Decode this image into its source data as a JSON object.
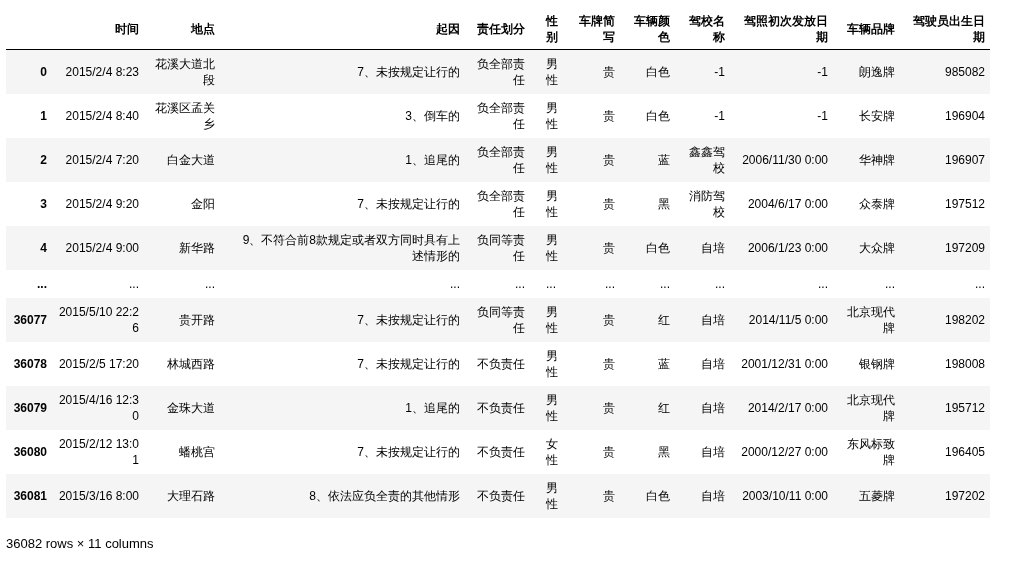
{
  "table": {
    "columns": [
      "时间",
      "地点",
      "起因",
      "责任划分",
      "性别",
      "车牌简写",
      "车辆颜色",
      "驾校名称",
      "驾照初次发放日期",
      "车辆品牌",
      "驾驶员出生日期"
    ],
    "rows": [
      {
        "index": "0",
        "cells": [
          "2015/2/4 8:23",
          "花溪大道北段",
          "7、未按规定让行的",
          "负全部责任",
          "男性",
          "贵",
          "白色",
          "-1",
          "-1",
          "朗逸牌",
          "985082"
        ]
      },
      {
        "index": "1",
        "cells": [
          "2015/2/4 8:40",
          "花溪区孟关乡",
          "3、倒车的",
          "负全部责任",
          "男性",
          "贵",
          "白色",
          "-1",
          "-1",
          "长安牌",
          "196904"
        ]
      },
      {
        "index": "2",
        "cells": [
          "2015/2/4 7:20",
          "白金大道",
          "1、追尾的",
          "负全部责任",
          "男性",
          "贵",
          "蓝",
          "鑫鑫驾校",
          "2006/11/30 0:00",
          "华神牌",
          "196907"
        ]
      },
      {
        "index": "3",
        "cells": [
          "2015/2/4 9:20",
          "金阳",
          "7、未按规定让行的",
          "负全部责任",
          "男性",
          "贵",
          "黑",
          "消防驾校",
          "2004/6/17 0:00",
          "众泰牌",
          "197512"
        ]
      },
      {
        "index": "4",
        "cells": [
          "2015/2/4 9:00",
          "新华路",
          "9、不符合前8款规定或者双方同时具有上述情形的",
          "负同等责任",
          "男性",
          "贵",
          "白色",
          "自培",
          "2006/1/23 0:00",
          "大众牌",
          "197209"
        ]
      },
      {
        "index": "...",
        "cells": [
          "...",
          "...",
          "...",
          "...",
          "...",
          "...",
          "...",
          "...",
          "...",
          "...",
          "..."
        ]
      },
      {
        "index": "36077",
        "cells": [
          "2015/5/10 22:26",
          "贵开路",
          "7、未按规定让行的",
          "负同等责任",
          "男性",
          "贵",
          "红",
          "自培",
          "2014/11/5 0:00",
          "北京现代牌",
          "198202"
        ]
      },
      {
        "index": "36078",
        "cells": [
          "2015/2/5 17:20",
          "林城西路",
          "7、未按规定让行的",
          "不负责任",
          "男性",
          "贵",
          "蓝",
          "自培",
          "2001/12/31 0:00",
          "银钢牌",
          "198008"
        ]
      },
      {
        "index": "36079",
        "cells": [
          "2015/4/16 12:30",
          "金珠大道",
          "1、追尾的",
          "不负责任",
          "男性",
          "贵",
          "红",
          "自培",
          "2014/2/17 0:00",
          "北京现代牌",
          "195712"
        ]
      },
      {
        "index": "36080",
        "cells": [
          "2015/2/12 13:01",
          "蟠桃宫",
          "7、未按规定让行的",
          "不负责任",
          "女性",
          "贵",
          "黑",
          "自培",
          "2000/12/27 0:00",
          "东风标致牌",
          "196405"
        ]
      },
      {
        "index": "36081",
        "cells": [
          "2015/3/16 8:00",
          "大理石路",
          "8、依法应负全责的其他情形",
          "不负责任",
          "男性",
          "贵",
          "白色",
          "自培",
          "2003/10/11 0:00",
          "五菱牌",
          "197202"
        ]
      }
    ]
  },
  "shape_caption": "36082 rows × 11 columns"
}
